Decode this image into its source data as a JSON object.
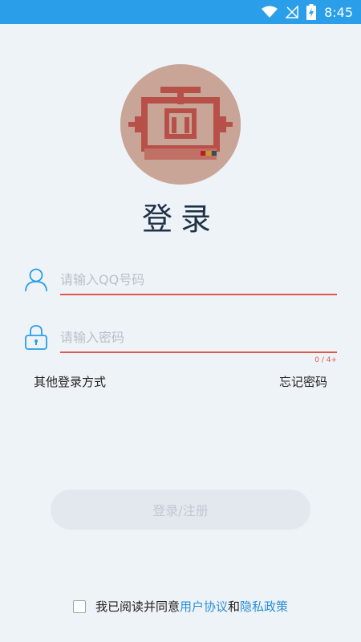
{
  "statusbar": {
    "time": "8:45"
  },
  "title": "登录",
  "fields": {
    "qq": {
      "placeholder": "请输入QQ号码",
      "value": ""
    },
    "password": {
      "placeholder": "请输入密码",
      "value": "",
      "counter": "0 / 4+"
    }
  },
  "links": {
    "other_login": "其他登录方式",
    "forgot_password": "忘记密码"
  },
  "login_button": "登录/注册",
  "agreement": {
    "prefix": "我已阅读并同意",
    "user_agreement": "用户协议",
    "and": "和",
    "privacy_policy": "隐私政策",
    "checked": false
  },
  "colors": {
    "statusbar": "#2a9ee8",
    "accent": "#e2574c",
    "link": "#2a8fd6",
    "icon": "#2a9ee8"
  },
  "icons": [
    "wifi-icon",
    "signal-off-icon",
    "battery-charging-icon",
    "user-icon",
    "lock-icon"
  ]
}
